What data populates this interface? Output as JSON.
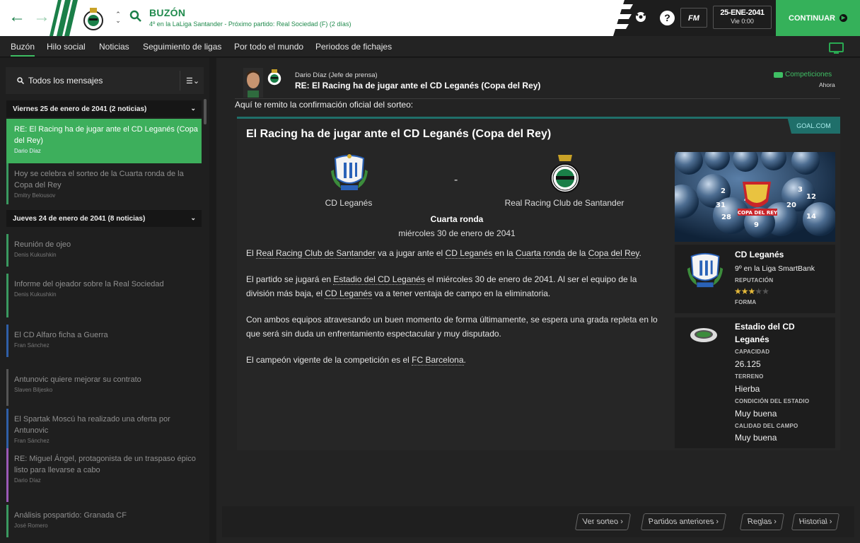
{
  "header": {
    "title": "BUZÓN",
    "subtitle": "4º en la LaLiga Santander - Próximo partido: Real Sociedad (F)  (2 días)",
    "date": "25-ENE-2041",
    "time": "Vie 0:00",
    "continue_label": "CONTINUAR",
    "fm_label": "FM",
    "help_label": "?"
  },
  "tabs": [
    "Buzón",
    "Hilo social",
    "Noticias",
    "Seguimiento de ligas",
    "Por todo el mundo",
    "Periodos de fichajes"
  ],
  "sidebar": {
    "filter_label": "Todos los mensajes",
    "groups": [
      {
        "label": "Viernes 25 de enero de 2041 (2 noticias)"
      },
      {
        "label": "Jueves 24 de enero de 2041 (8 noticias)"
      }
    ],
    "messages": [
      {
        "title": "RE: El Racing ha de jugar ante el CD Leganés (Copa del Rey)",
        "author": "Dario Díaz",
        "color": "#3daf5c"
      },
      {
        "title": "Hoy se celebra el sorteo de la Cuarta ronda de la Copa del Rey",
        "author": "Dmitry Belousov",
        "color": "#3a9960"
      },
      {
        "title": "Reunión de ojeo",
        "author": "Denis Kukushkin",
        "color": "#3a9960"
      },
      {
        "title": "Informe del ojeador sobre la Real Sociedad",
        "author": "Denis Kukushkin",
        "color": "#3a9960"
      },
      {
        "title": "El CD Alfaro ficha a Guerra",
        "author": "Fran Sánchez",
        "color": "#2f5fa8"
      },
      {
        "title": "Antunovic quiere mejorar su contrato",
        "author": "Slaven Biljesko",
        "color": "#555555"
      },
      {
        "title": "El Spartak Moscú ha realizado una oferta por Antunovic",
        "author": "Fran Sánchez",
        "color": "#2f5fa8"
      },
      {
        "title": "RE: Miguel Ángel, protagonista de un traspaso épico listo para llevarse a cabo",
        "author": "Dario Díaz",
        "color": "#9b59b6"
      },
      {
        "title": "Análisis pospartido: Granada CF",
        "author": "José Romero",
        "color": "#3a9960"
      }
    ]
  },
  "message": {
    "sender": "Dario Díaz  (Jefe de prensa)",
    "subject": "RE: El Racing ha de jugar ante el CD Leganés (Copa del Rey)",
    "category": "Competiciones",
    "time_ago": "Ahora",
    "intro": "Aquí te remito la confirmación oficial del sorteo:"
  },
  "article": {
    "source": "GOAL.COM",
    "title": "El Racing ha de jugar ante el CD Leganés (Copa del Rey)",
    "home_team": "CD Leganés",
    "away_team": "Real Racing Club de Santander",
    "separator": "-",
    "round": "Cuarta ronda",
    "date": "miércoles 30 de enero de 2041",
    "p1": {
      "t1": "El ",
      "l1": "Real Racing Club de Santander",
      "t2": " va a jugar ante el ",
      "l2": "CD Leganés",
      "t3": " en la ",
      "l3": "Cuarta ronda",
      "t4": " de la ",
      "l4": "Copa del Rey",
      "t5": "."
    },
    "p2": {
      "t1": "El partido se jugará en ",
      "l1": "Estadio del CD Leganés",
      "t2": " el miércoles 30 de enero de 2041. Al ser el equipo de la división más baja, el ",
      "l2": "CD Leganés",
      "t3": " va a tener ventaja de campo en la eliminatoria."
    },
    "p3": "Con ambos equipos atravesando un buen momento de forma últimamente, se espera una grada repleta en lo que será sin duda un enfrentamiento espectacular y muy disputado.",
    "p4": {
      "t1": "El campeón vigente de la competición es el ",
      "l1": "FC Barcelona",
      "t2": "."
    }
  },
  "cup_image": {
    "caption": "COPA DEL REY"
  },
  "club_card": {
    "name": "CD Leganés",
    "position": "9º en la Liga SmartBank",
    "rep_label": "REPUTACIÓN",
    "rep_stars": 3,
    "rep_max": 5,
    "form_label": "FORMA"
  },
  "stadium_card": {
    "name_line1": "Estadio del CD",
    "name_line2": "Leganés",
    "capacity_label": "CAPACIDAD",
    "capacity": "26.125",
    "surface_label": "TERRENO",
    "surface": "Hierba",
    "condition_label": "CONDICIÓN DEL ESTADIO",
    "condition": "Muy buena",
    "pitch_label": "CALIDAD DEL CAMPO",
    "pitch": "Muy buena"
  },
  "bottom_buttons": [
    "Ver sorteo",
    "Partidos anteriores",
    "Reglas",
    "Historial"
  ],
  "colors": {
    "accent": "#3daf5c",
    "brand_green": "#1f8a4c",
    "teal": "#1f6f6a"
  }
}
